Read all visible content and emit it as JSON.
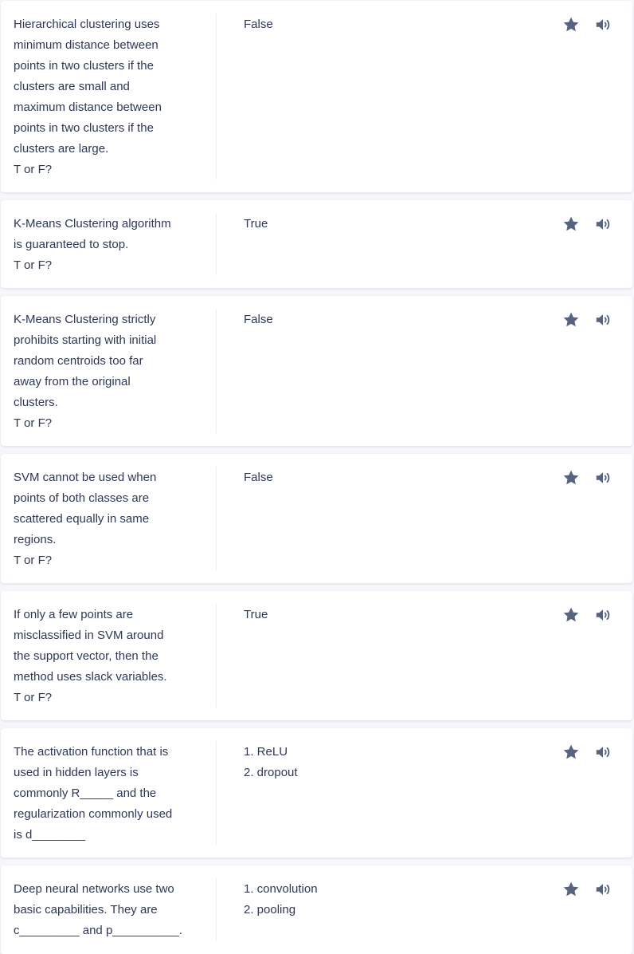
{
  "colors": {
    "text": "#2e3856",
    "icon": "#586380",
    "card": "#ffffff",
    "background": "#f6f7fb"
  },
  "icons": {
    "star": "star-icon",
    "audio": "audio-icon"
  },
  "cards": [
    {
      "term": "Hierarchical clustering uses\nminimum distance between\npoints in two clusters if the\nclusters are small and\nmaximum distance between\npoints in two clusters if the\nclusters are large.\nT or F?",
      "definition": "False"
    },
    {
      "term": "K-Means Clustering algorithm\nis guaranteed to stop.\nT or F?",
      "definition": "True"
    },
    {
      "term": "K-Means Clustering strictly\nprohibits starting with initial\nrandom centroids too far\naway from the original\nclusters.\nT or F?",
      "definition": "False"
    },
    {
      "term": "SVM cannot be used when\npoints of both classes are\nscattered equally in same\nregions.\nT or F?",
      "definition": "False"
    },
    {
      "term": "If only a few points are\nmisclassified in SVM around\nthe support vector, then the\nmethod uses slack variables.\nT or F?",
      "definition": "True"
    },
    {
      "term": "The activation function that is\nused in hidden layers is\ncommonly R_____ and the\nregularization commonly used\nis d________",
      "definition": "1. ReLU\n2. dropout"
    },
    {
      "term": "Deep neural networks use two\nbasic capabilities. They are\nc_________ and p__________.",
      "definition": "1. convolution\n2. pooling"
    }
  ]
}
